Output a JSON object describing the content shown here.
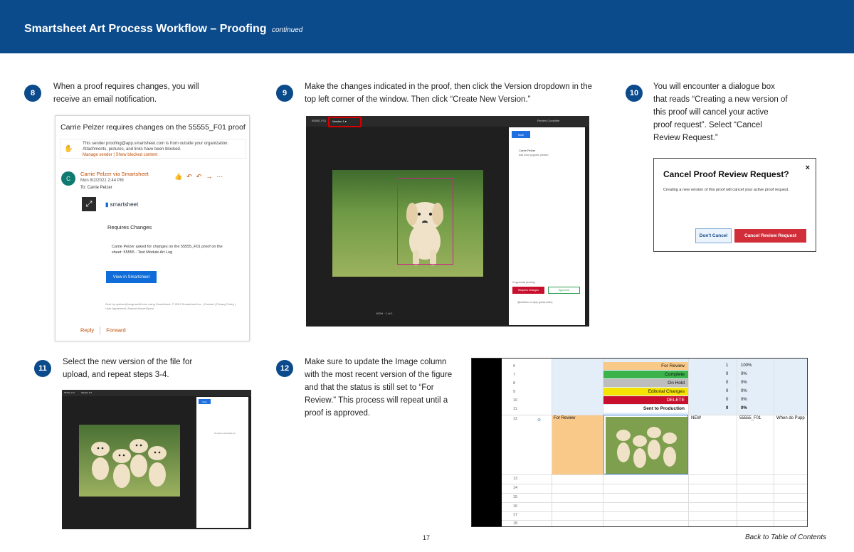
{
  "header": {
    "title": "Smartsheet Art Process Workflow – Proofing",
    "continued": "continued"
  },
  "steps": [
    {
      "number": "8",
      "text": "When a proof requires changes, you will receive an email notification."
    },
    {
      "number": "9",
      "text": "Make the changes indicated in the proof, then click the Version dropdown in the top left corner of the window. Then click “Create New Version.”"
    },
    {
      "number": "10",
      "text": "You will encounter a dialogue box that reads “Creating a new version of this proof will cancel your active proof request”. Select “Cancel Review Request.”"
    },
    {
      "number": "11",
      "text": "Select the new version of the file for upload, and repeat steps 3-4."
    },
    {
      "number": "12",
      "text": "Make sure to update the Image column with the most recent version of the figure and that the status is still set to “For Review.” This process will repeat until a proof is approved."
    }
  ],
  "email": {
    "subject": "Carrie Pelzer requires changes on the 55555_F01 proof",
    "warning": "This sender proofing@app.smartsheet.com is from outside your organization. Attachments, pictures, and links have been blocked.",
    "warning_links": "Manage sender | Show blocked content",
    "avatar_letter": "C",
    "from": "Carrie Pelzer via Smartsheet",
    "date": "Mon 8/2/2021 2:44 PM",
    "to": "To: Carrie Pelzer",
    "brand": "smartsheet",
    "requires_heading": "Requires Changes",
    "body": "Carrie Pelzer asked for changes on the 55555_F01 proof on the sheet: 55555 - Test Module Art Log",
    "view_button": "View in Smartsheet",
    "footer": "Sent by cpelzer@mcgrawhill.com using Smartsheet. © 2021 Smartsheet Inc. | Contact | Privacy Policy | User Agreement | Report Abuse/Spam",
    "reply": "Reply",
    "forward": "Forward"
  },
  "proof_window": {
    "file_name": "55555_F01",
    "version_label": "Version 1 ▾",
    "review_complete": "Review Complete",
    "note_button": "Note",
    "comment_author": "Carrie Pelzer",
    "comment_body": "Add more puppies, please!",
    "zoom": "100%",
    "pages": "1 of 1",
    "pending": "0 approvals pending",
    "request_changes": "Requires Changes",
    "approved": "Approved",
    "footnote": "@mention or reply (press enter)"
  },
  "proof_window_2": {
    "file_name": "55555_F01",
    "version_label": "Version 2 ▾",
    "note_button": "Note",
    "empty_text": "No notes or comments yet"
  },
  "dialog": {
    "title": "Cancel Proof Review Request?",
    "close": "×",
    "body": "Creating a new version of this proof will cancel your active proof request.",
    "dont_cancel": "Don't Cancel",
    "cancel_request": "Cancel Review Request"
  },
  "sheet": {
    "status_rows": [
      {
        "row": "6",
        "label": "For Review",
        "count": "1",
        "pct": "100%",
        "color": "#f9c98a"
      },
      {
        "row": "7",
        "label": "Complete",
        "count": "0",
        "pct": "0%",
        "color": "#3cb34a"
      },
      {
        "row": "8",
        "label": "On Hold",
        "count": "0",
        "pct": "0%",
        "color": "#bdbdbd"
      },
      {
        "row": "9",
        "label": "Editorial Changes",
        "count": "0",
        "pct": "0%",
        "color": "#f5e400"
      },
      {
        "row": "10",
        "label": "DELETE",
        "count": "0",
        "pct": "0%",
        "color": "#c8102e"
      },
      {
        "row": "11",
        "label": "Sent to Production",
        "count": "0",
        "pct": "0%",
        "color": "#ffffff"
      }
    ],
    "row12": {
      "row": "12",
      "status": "For Review",
      "version": "NEW",
      "figure": "55555_F01",
      "caption": "When do Pupp"
    },
    "empty_rows": [
      "13",
      "14",
      "15",
      "16",
      "17",
      "18"
    ]
  },
  "footer": {
    "page_number": "17",
    "back_link": "Back to Table of Contents"
  }
}
